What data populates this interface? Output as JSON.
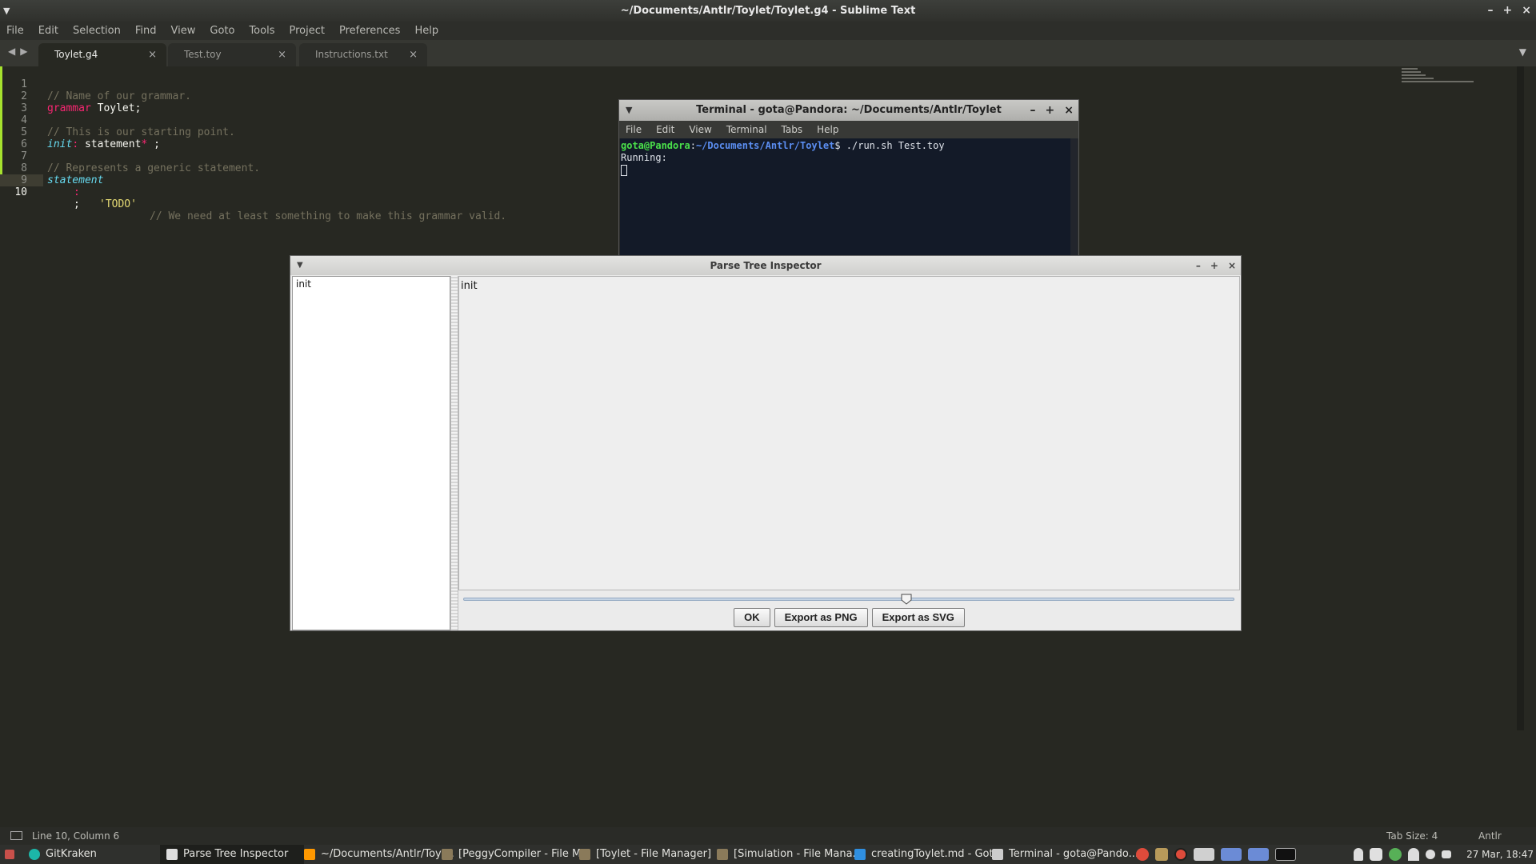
{
  "sublime": {
    "title": "~/Documents/Antlr/Toylet/Toylet.g4 - Sublime Text",
    "menu": [
      "File",
      "Edit",
      "Selection",
      "Find",
      "View",
      "Goto",
      "Tools",
      "Project",
      "Preferences",
      "Help"
    ],
    "tabs": [
      {
        "label": "Toylet.g4",
        "active": true
      },
      {
        "label": "Test.toy",
        "active": false
      },
      {
        "label": "Instructions.txt",
        "active": false
      }
    ],
    "close_glyph": "×",
    "code": {
      "line_numbers": [
        "1",
        "2",
        "3",
        "4",
        "5",
        "6",
        "7",
        "8",
        "9",
        "10"
      ],
      "l1": "// Name of our grammar.",
      "l2_kw": "grammar",
      "l2_rest": " Toylet;",
      "l4": "// This is our starting point.",
      "l5_rule": "init",
      "l5_colon": ":",
      "l5_rest": " statement",
      "l5_star": "*",
      "l5_end": " ;",
      "l7": "// Represents a generic statement.",
      "l8_rule": "statement",
      "l9_colon": ":",
      "l9_str": "'TODO'",
      "l9_cmt": "// We need at least something to make this grammar valid.",
      "l10": ";"
    },
    "status": {
      "position": "Line 10, Column 6",
      "tab_size": "Tab Size: 4",
      "syntax": "Antlr"
    }
  },
  "terminal": {
    "title": "Terminal - gota@Pandora: ~/Documents/Antlr/Toylet",
    "menu": [
      "File",
      "Edit",
      "View",
      "Terminal",
      "Tabs",
      "Help"
    ],
    "prompt_user": "gota@Pandora",
    "prompt_sep": ":",
    "prompt_path": "~/Documents/Antlr/Toylet",
    "prompt_cmd": "$ ./run.sh Test.toy",
    "output": "Running:"
  },
  "inspector": {
    "title": "Parse Tree Inspector",
    "tree_root": "init",
    "canvas_node": "init",
    "slider_value": 0.575,
    "buttons": {
      "ok": "OK",
      "png": "Export as PNG",
      "svg": "Export as SVG"
    }
  },
  "taskbar": {
    "items": [
      {
        "label": "GitKraken",
        "color": "#1cb6a8"
      },
      {
        "label": "Parse Tree Inspector",
        "color": "#dddddd"
      },
      {
        "label": "~/Documents/Antlr/Toyl...",
        "color": "#ff9800"
      },
      {
        "label": "[PeggyCompiler - File M...",
        "color": "#8a7a5a"
      },
      {
        "label": "[Toylet - File Manager]",
        "color": "#8a7a5a"
      },
      {
        "label": "[Simulation - File Mana...",
        "color": "#8a7a5a"
      },
      {
        "label": "creatingToylet.md - Got...",
        "color": "#2f8fe0"
      },
      {
        "label": "Terminal - gota@Pando...",
        "color": "#cccccc"
      }
    ],
    "clock": "27 Mar, 18:47"
  }
}
